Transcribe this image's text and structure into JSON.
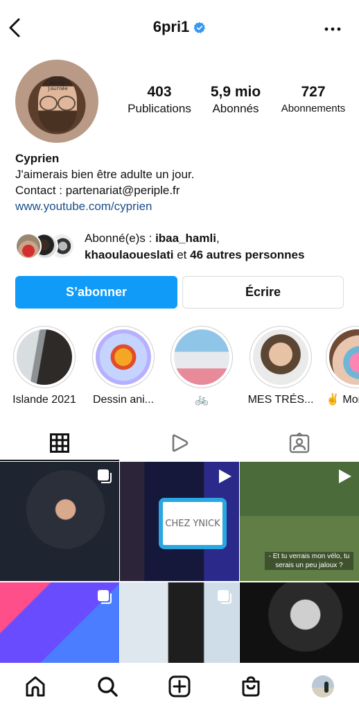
{
  "header": {
    "username": "6pri1",
    "verified": true,
    "back_icon": "chevron-left-icon",
    "more_icon": "more-horizontal-icon"
  },
  "profile": {
    "avatar_forehead_text": [
      "Bonne",
      "journée"
    ],
    "stats": [
      {
        "value": "403",
        "label": "Publications"
      },
      {
        "value": "5,9 mio",
        "label": "Abonnés"
      },
      {
        "value": "727",
        "label": "Abonnements"
      }
    ],
    "name": "Cyprien",
    "bio_lines": [
      "J'aimerais bien être adulte un jour.",
      "Contact : partenariat@periple.fr"
    ],
    "link": "www.youtube.com/cyprien"
  },
  "followed_by": {
    "prefix": "Abonné(e)s : ",
    "user1": "ibaa_hamli",
    "sep": ",",
    "user2": "khaoulaoueslati",
    "middle": " et ",
    "others": "46 autres personnes"
  },
  "actions": {
    "follow_label": "S’abonner",
    "message_label": "Écrire",
    "follow_color": "#0f9bf7"
  },
  "highlights": [
    {
      "label": "Islande 2021"
    },
    {
      "label": "Dessin ani..."
    },
    {
      "label": "🚲"
    },
    {
      "label": "MES TRÉS..."
    },
    {
      "label": "✌️ Mon"
    }
  ],
  "tabs": [
    {
      "icon": "grid-icon",
      "active": true
    },
    {
      "icon": "reels-play-icon",
      "active": false
    },
    {
      "icon": "tagged-person-icon",
      "active": false
    }
  ],
  "posts": [
    {
      "type": "carousel",
      "overlay_icon": "carousel-icon"
    },
    {
      "type": "video",
      "overlay_icon": "play-icon",
      "board_text": "CHEZ YNICK"
    },
    {
      "type": "video",
      "overlay_icon": "play-icon",
      "subtitle": "- Et tu verrais mon vélo, tu serais un peu jaloux ?"
    },
    {
      "type": "carousel",
      "overlay_icon": "carousel-icon"
    },
    {
      "type": "carousel",
      "overlay_icon": "carousel-icon"
    },
    {
      "type": "image"
    }
  ],
  "bottom_nav": [
    {
      "icon": "home-icon"
    },
    {
      "icon": "search-icon"
    },
    {
      "icon": "new-post-icon"
    },
    {
      "icon": "shop-icon"
    },
    {
      "icon": "profile-avatar"
    }
  ]
}
